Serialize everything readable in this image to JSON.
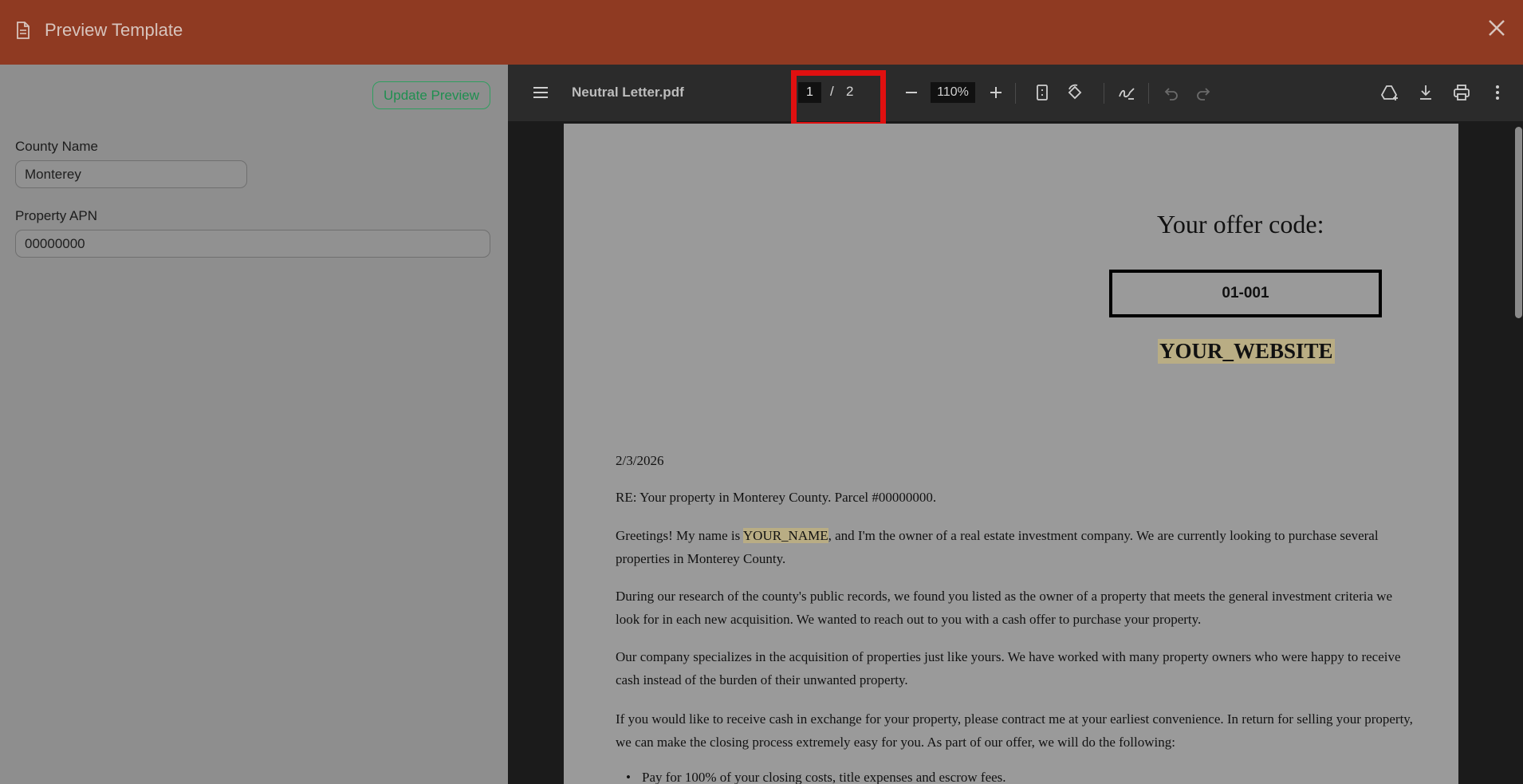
{
  "header": {
    "title": "Preview Template"
  },
  "form": {
    "update_button": "Update Preview",
    "county_label": "County Name",
    "county_value": "Monterey",
    "apn_label": "Property APN",
    "apn_value": "00000000"
  },
  "toolbar": {
    "file_name": "Neutral Letter.pdf",
    "current_page": "1",
    "page_separator": "/",
    "total_pages": "2",
    "zoom": "110%",
    "icons": [
      "menu-icon",
      "zoom-out-icon",
      "zoom-in-icon",
      "fit-page-icon",
      "rotate-icon",
      "annotate-icon",
      "undo-icon",
      "redo-icon",
      "add-drive-icon",
      "download-icon",
      "print-icon",
      "more-icon"
    ]
  },
  "document": {
    "offer_title": "Your offer code:",
    "offer_code": "01-001",
    "website": "YOUR_WEBSITE",
    "date": "2/3/2026",
    "re_line": "RE: Your property in Monterey County. Parcel #00000000.",
    "greeting_pre": "Greetings! My name is ",
    "greeting_name": "YOUR_NAME",
    "greeting_post": ", and I'm the owner of a real estate investment company. We are currently looking to purchase several properties in Monterey County.",
    "para2": "During our research of the county's public records, we found you listed as the owner of a property that meets the general investment criteria we look for in each new acquisition. We wanted to reach out to you with a cash offer to purchase your property.",
    "para3": "Our company specializes in the acquisition of properties just like yours. We have worked with many property owners who were happy to receive cash instead of the burden of their unwanted property.",
    "para4": "If you would like to receive cash in exchange for your property, please contract me at your earliest convenience. In return for selling your property, we can make the closing process extremely easy for you. As part of our offer, we will do the following:",
    "bullet1": "Pay for 100% of your closing costs, title expenses and escrow fees."
  }
}
